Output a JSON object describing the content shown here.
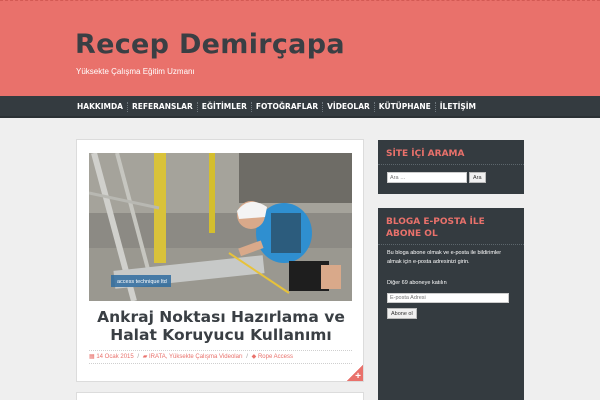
{
  "site": {
    "title": "Recep Demirçapa",
    "description": "Yüksekte Çalışma Eğitim Uzmanı"
  },
  "nav": {
    "items": [
      "HAKKIMDA",
      "REFERANSLAR",
      "EĞİTİMLER",
      "FOTOĞRAFLAR",
      "VİDEOLAR",
      "KÜTÜPHANE",
      "İLETİŞİM"
    ]
  },
  "post": {
    "image_caption": "access technique ltd",
    "title": "Ankraj Noktası Hazırlama ve Halat Koruyucu Kullanımı",
    "date": "14 Ocak 2015",
    "categories": "IRATA, Yüksekte Çalışma Videoları",
    "tags": "Rope Access",
    "more_icon": "plus-icon"
  },
  "sidebar": {
    "search": {
      "title": "SİTE İÇİ ARAMA",
      "placeholder": "Ara …",
      "button": "Ara"
    },
    "subscribe": {
      "title": "BLOGA E-POSTA İLE ABONE OL",
      "text": "Bu bloga abone olmak ve e-posta ile bildirimler almak için e-posta adresinizi girin.",
      "count_text": "Diğer 69 aboneye katılın",
      "email_placeholder": "E-posta Adresi",
      "button": "Abone ol"
    }
  },
  "colors": {
    "accent": "#e9716b",
    "dark": "#343b40",
    "background": "#efefef"
  }
}
